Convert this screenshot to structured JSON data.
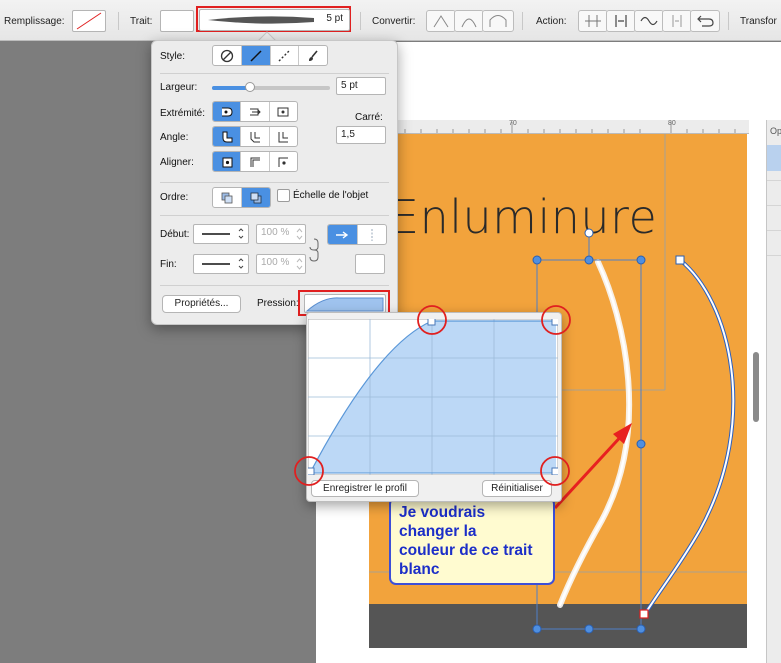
{
  "toolbar": {
    "fill_label": "Remplissage:",
    "stroke_label": "Trait:",
    "stroke_width": "5 pt",
    "convert_label": "Convertir:",
    "action_label": "Action:",
    "transform_label": "Transfor"
  },
  "popover": {
    "style_label": "Style:",
    "width_label": "Largeur:",
    "width_value": "5 pt",
    "width_slider_level": 0.32,
    "cap_label": "Extrémité:",
    "join_label": "Angle:",
    "align_label": "Aligner:",
    "miter_label": "Carré:",
    "miter_value": "1,5",
    "order_label": "Ordre:",
    "scale_label": "Échelle de l'objet",
    "start_label": "Début:",
    "end_label": "Fin:",
    "start_percent": "100 %",
    "end_percent": "100 %",
    "properties_button": "Propriétés...",
    "pressure_label": "Pression:"
  },
  "pressure_curve": {
    "save_button": "Enregistrer le profil",
    "reset_button": "Réinitialiser"
  },
  "canvas": {
    "title_text": "Enluminure",
    "ruler_ticks": [
      "70",
      "80"
    ]
  },
  "annotation": {
    "line1": "Je voudrais",
    "line2": "changer la",
    "line3": "couleur de ce trait",
    "line4": "blanc"
  },
  "side_panel": {
    "label": "Op"
  },
  "colors": {
    "accent": "#4a90e2",
    "highlight": "#e02020",
    "canvas_orange": "#f2a33c",
    "note_text": "#1c2ec8"
  }
}
